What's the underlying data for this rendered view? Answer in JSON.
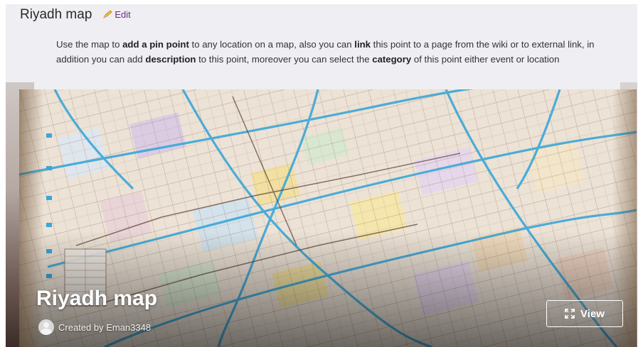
{
  "header": {
    "title": "Riyadh map",
    "edit_label": "Edit",
    "edit_icon": "pencil-icon"
  },
  "description": {
    "p1": "Use the map to ",
    "b1": "add a pin point",
    "p2": " to any location on a map, also you can ",
    "b2": "link",
    "p3": " this point to a page from the wiki or to external link, in addition you can add ",
    "b3": "description",
    "p4": " to this point, moreover you can select the ",
    "b4": "category",
    "p5": " of this point either event or location"
  },
  "map_card": {
    "title": "Riyadh map",
    "creator": "Created by Eman3348",
    "view_label": "View",
    "view_icon": "expand-icon"
  },
  "colors": {
    "edit_link": "#6a2c86",
    "major_road": "#3aa7d8",
    "map_paper": "#ede4da"
  }
}
